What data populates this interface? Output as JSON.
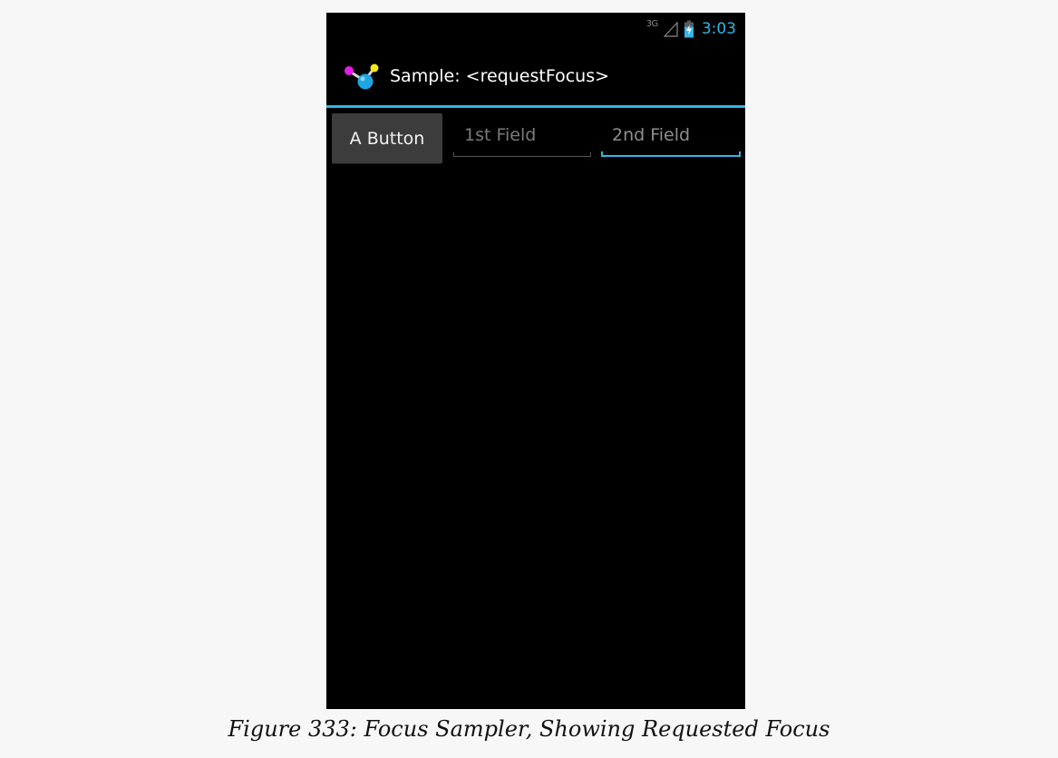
{
  "status_bar": {
    "network_type": "3G",
    "signal_icon": "signal-triangle-icon",
    "battery_icon": "battery-charging-icon",
    "time": "3:03"
  },
  "action_bar": {
    "app_icon": "molecule-app-icon",
    "title": "Sample: <requestFocus>"
  },
  "content": {
    "button_label": "A Button",
    "field_1": {
      "value": "",
      "placeholder": "1st Field"
    },
    "field_2": {
      "value": "",
      "placeholder": "2nd Field",
      "focused": true
    }
  },
  "caption": "Figure 333: Focus Sampler, Showing Requested Focus",
  "colors": {
    "accent": "#33b5e5",
    "background": "#000000",
    "button": "#3c3c3c",
    "page": "#f7f7f7"
  }
}
